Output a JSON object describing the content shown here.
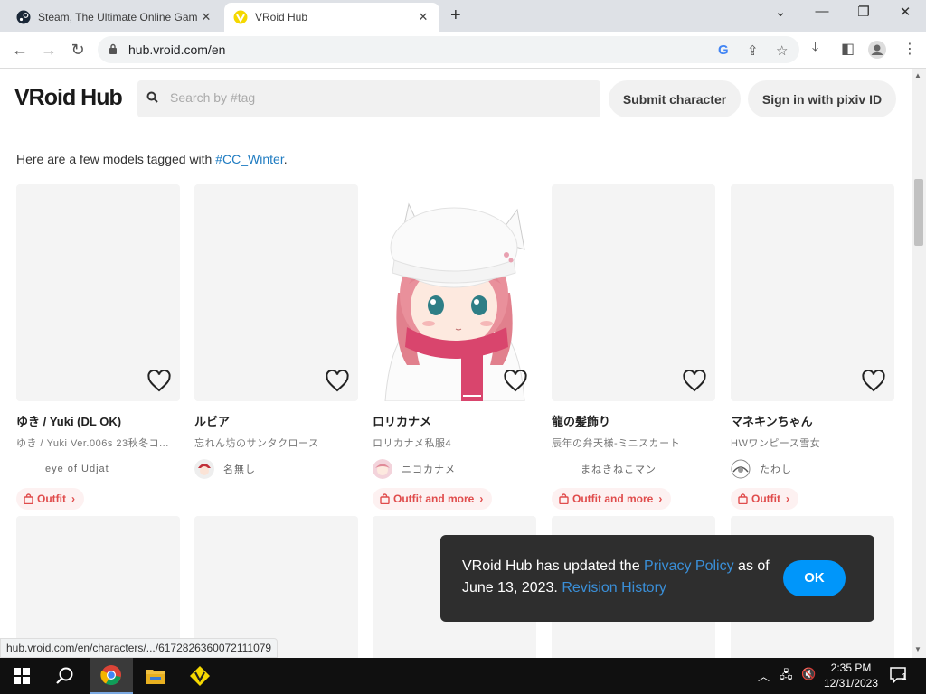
{
  "browser": {
    "tabs": [
      {
        "title": "Steam, The Ultimate Online Gam",
        "active": false
      },
      {
        "title": "VRoid Hub",
        "active": true
      }
    ],
    "url": "hub.vroid.com/en",
    "status_url": "hub.vroid.com/en/characters/.../6172826360072111079"
  },
  "site": {
    "logo": "VRoid Hub",
    "search_placeholder": "Search by #tag",
    "submit_label": "Submit character",
    "signin_label": "Sign in with pixiv ID",
    "intro_text": "Here are a few models tagged with ",
    "intro_tag": "#CC_Winter",
    "intro_end": "."
  },
  "cards": [
    {
      "name": "ゆき / Yuki (DL OK)",
      "subtitle": "ゆき / Yuki Ver.006s 23秋冬コ...",
      "author": "eye of Udjat",
      "outfit": "Outfit"
    },
    {
      "name": "ルビア",
      "subtitle": "忘れん坊のサンタクロース",
      "author": "名無し",
      "outfit": null
    },
    {
      "name": "ロリカナメ",
      "subtitle": "ロリカナメ私服4",
      "author": "ニコカナメ",
      "outfit": "Outfit and more"
    },
    {
      "name": "龍の髪飾り",
      "subtitle": "辰年の弁天様-ミニスカート",
      "author": "まねきねこマン",
      "outfit": "Outfit and more"
    },
    {
      "name": "マネキンちゃん",
      "subtitle": "HWワンピース雪女",
      "author": "たわし",
      "outfit": "Outfit"
    }
  ],
  "toast": {
    "text1": "VRoid Hub has updated the ",
    "link1": "Privacy Policy",
    "text2": " as of June 13, 2023. ",
    "link2": "Revision History",
    "ok": "OK"
  },
  "taskbar": {
    "time": "2:35 PM",
    "date": "12/31/2023",
    "notification_count": "1"
  },
  "colors": {
    "accent": "#0096fa",
    "tag_link": "#1e7bc1",
    "outfit_red": "#e04c4c"
  }
}
